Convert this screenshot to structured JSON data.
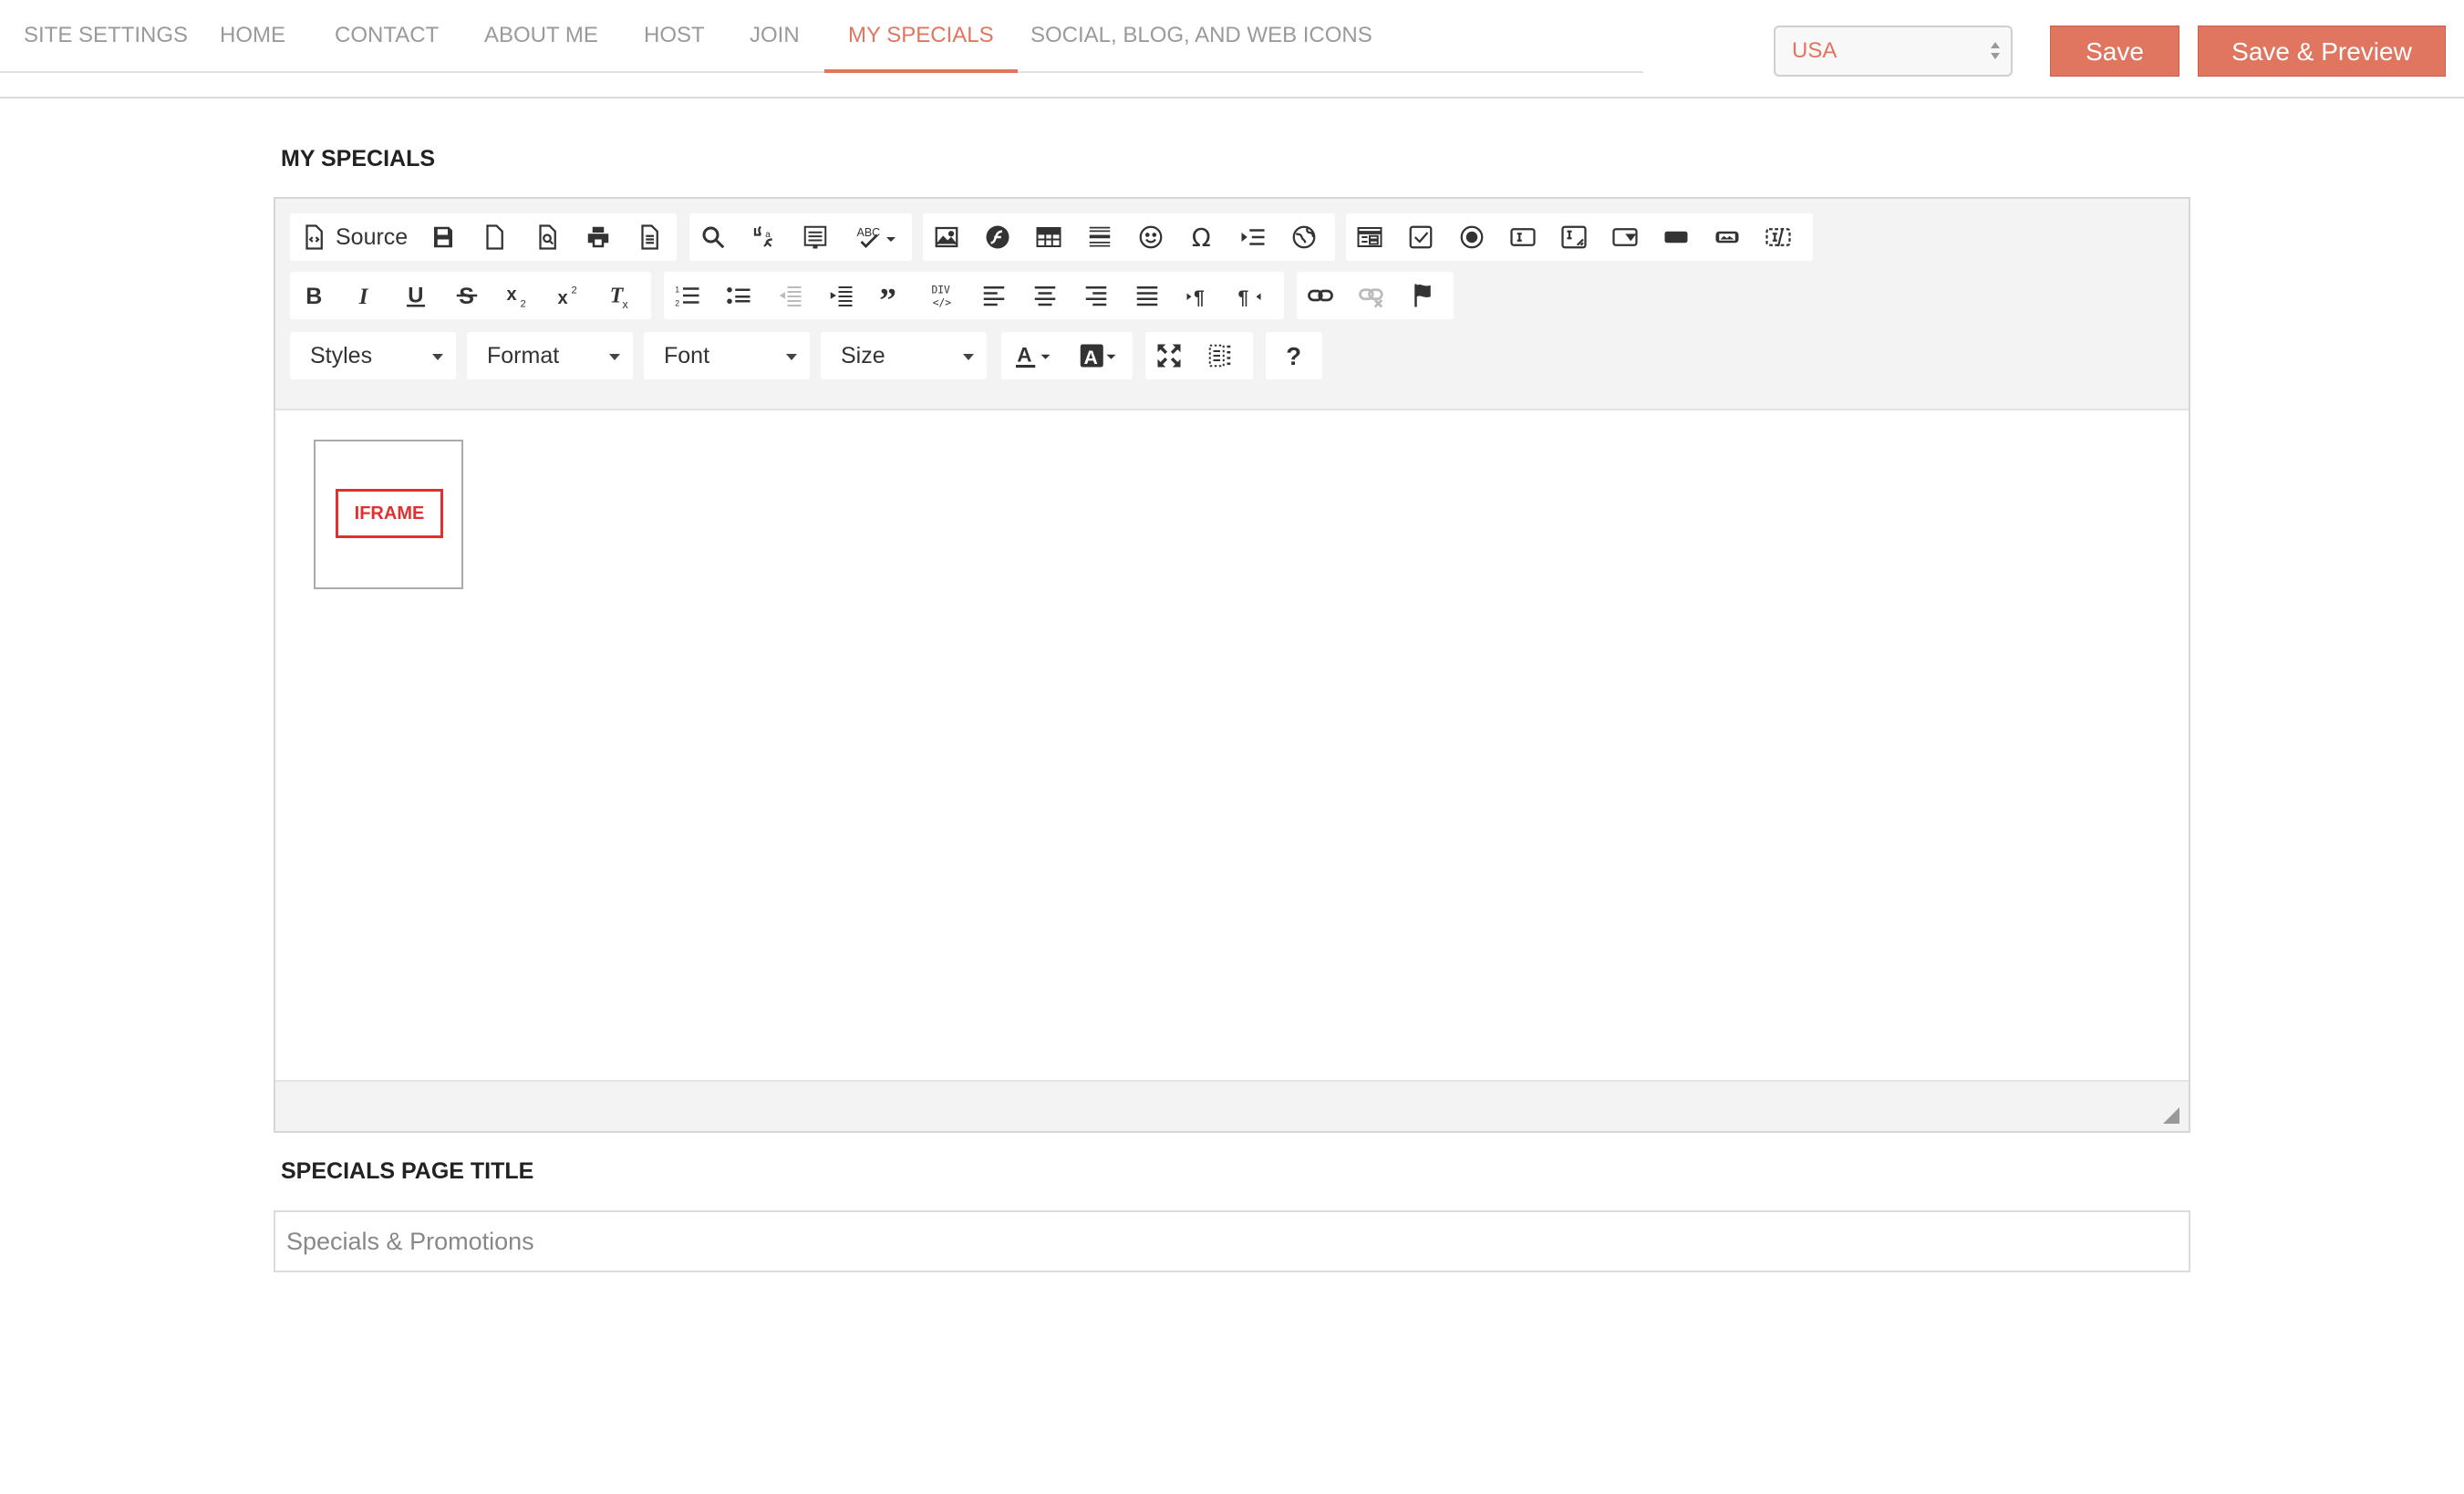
{
  "tabs": [
    {
      "label": "SITE SETTINGS"
    },
    {
      "label": "HOME"
    },
    {
      "label": "CONTACT"
    },
    {
      "label": "ABOUT ME"
    },
    {
      "label": "HOST"
    },
    {
      "label": "JOIN"
    },
    {
      "label": "MY SPECIALS",
      "active": true
    },
    {
      "label": "SOCIAL, BLOG, AND WEB ICONS"
    }
  ],
  "country_select": {
    "value": "USA"
  },
  "actions": {
    "save": "Save",
    "save_preview": "Save & Preview"
  },
  "section": {
    "label": "MY SPECIALS"
  },
  "editor": {
    "source_label": "Source",
    "combos": {
      "styles": "Styles",
      "format": "Format",
      "font": "Font",
      "size": "Size"
    },
    "placeholder_badge": "IFRAME"
  },
  "page_title": {
    "label": "SPECIALS PAGE TITLE",
    "value": "Specials & Promotions"
  },
  "colors": {
    "accent": "#e07560",
    "placeholder_red": "#e03030"
  }
}
